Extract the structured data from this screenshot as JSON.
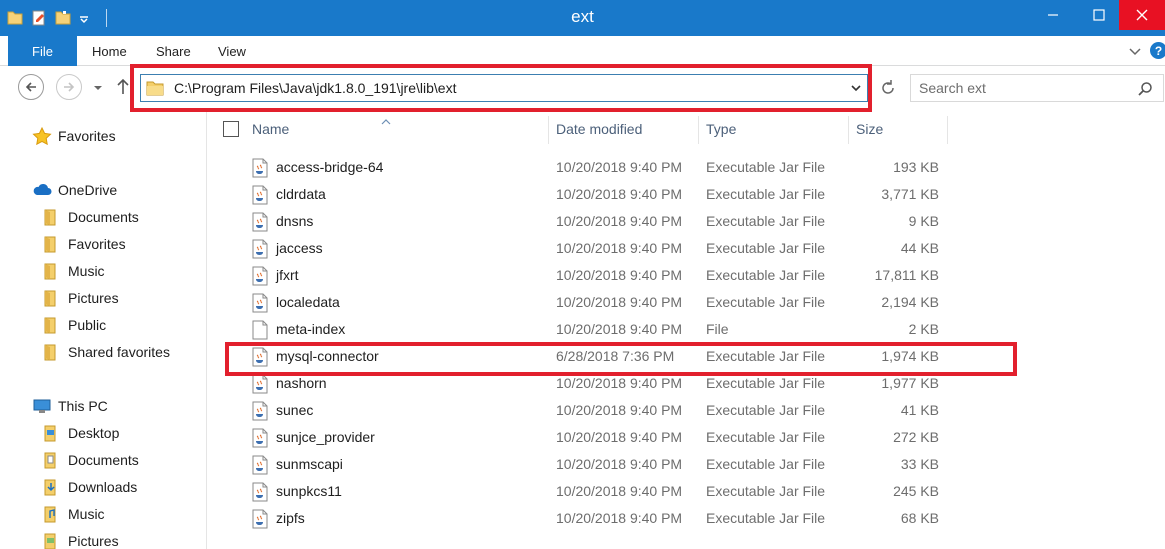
{
  "window": {
    "title": "ext"
  },
  "ribbon": {
    "tabs": [
      "File",
      "Home",
      "Share",
      "View"
    ],
    "help": "?"
  },
  "address": {
    "path": "C:\\Program Files\\Java\\jdk1.8.0_191\\jre\\lib\\ext"
  },
  "search": {
    "placeholder": "Search ext"
  },
  "columns": {
    "name": "Name",
    "date": "Date modified",
    "type": "Type",
    "size": "Size"
  },
  "nav": {
    "favorites": "Favorites",
    "onedrive": "OneDrive",
    "onedrive_items": [
      "Documents",
      "Favorites",
      "Music",
      "Pictures",
      "Public",
      "Shared favorites"
    ],
    "thispc": "This PC",
    "thispc_items": [
      "Desktop",
      "Documents",
      "Downloads",
      "Music",
      "Pictures"
    ]
  },
  "files": [
    {
      "name": "access-bridge-64",
      "date": "10/20/2018 9:40 PM",
      "type": "Executable Jar File",
      "size": "193 KB",
      "icon": "jar-icon"
    },
    {
      "name": "cldrdata",
      "date": "10/20/2018 9:40 PM",
      "type": "Executable Jar File",
      "size": "3,771 KB",
      "icon": "jar-icon"
    },
    {
      "name": "dnsns",
      "date": "10/20/2018 9:40 PM",
      "type": "Executable Jar File",
      "size": "9 KB",
      "icon": "jar-icon"
    },
    {
      "name": "jaccess",
      "date": "10/20/2018 9:40 PM",
      "type": "Executable Jar File",
      "size": "44 KB",
      "icon": "jar-icon"
    },
    {
      "name": "jfxrt",
      "date": "10/20/2018 9:40 PM",
      "type": "Executable Jar File",
      "size": "17,811 KB",
      "icon": "jar-icon"
    },
    {
      "name": "localedata",
      "date": "10/20/2018 9:40 PM",
      "type": "Executable Jar File",
      "size": "2,194 KB",
      "icon": "jar-icon"
    },
    {
      "name": "meta-index",
      "date": "10/20/2018 9:40 PM",
      "type": "File",
      "size": "2 KB",
      "icon": "file-icon"
    },
    {
      "name": "mysql-connector",
      "date": "6/28/2018 7:36 PM",
      "type": "Executable Jar File",
      "size": "1,974 KB",
      "icon": "jar-icon"
    },
    {
      "name": "nashorn",
      "date": "10/20/2018 9:40 PM",
      "type": "Executable Jar File",
      "size": "1,977 KB",
      "icon": "jar-icon"
    },
    {
      "name": "sunec",
      "date": "10/20/2018 9:40 PM",
      "type": "Executable Jar File",
      "size": "41 KB",
      "icon": "jar-icon"
    },
    {
      "name": "sunjce_provider",
      "date": "10/20/2018 9:40 PM",
      "type": "Executable Jar File",
      "size": "272 KB",
      "icon": "jar-icon"
    },
    {
      "name": "sunmscapi",
      "date": "10/20/2018 9:40 PM",
      "type": "Executable Jar File",
      "size": "33 KB",
      "icon": "jar-icon"
    },
    {
      "name": "sunpkcs11",
      "date": "10/20/2018 9:40 PM",
      "type": "Executable Jar File",
      "size": "245 KB",
      "icon": "jar-icon"
    },
    {
      "name": "zipfs",
      "date": "10/20/2018 9:40 PM",
      "type": "Executable Jar File",
      "size": "68 KB",
      "icon": "jar-icon"
    }
  ],
  "colors": {
    "accent": "#1979ca",
    "highlight": "#e2202d",
    "close": "#e81123"
  }
}
